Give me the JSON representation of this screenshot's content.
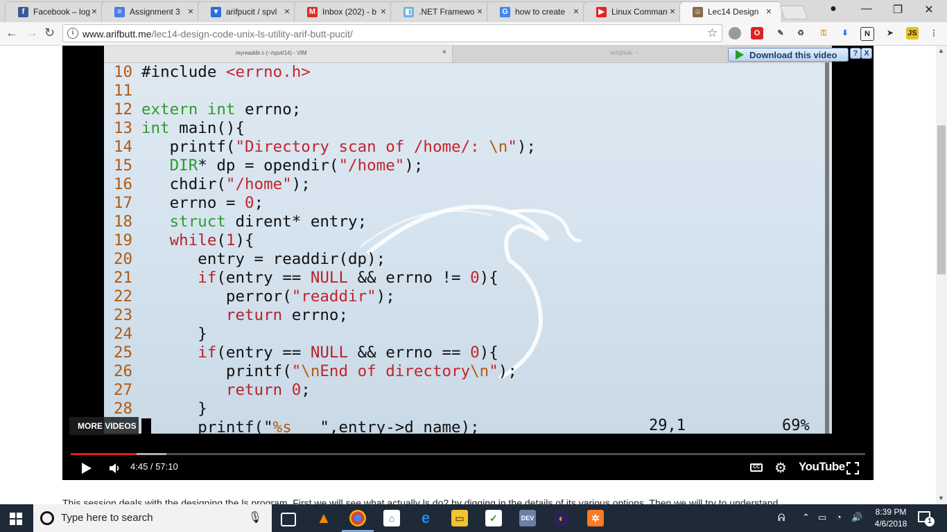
{
  "tabs": [
    {
      "title": "Facebook – log",
      "color": "#3b5998",
      "glyph": "f",
      "active": false
    },
    {
      "title": "Assignment 3",
      "color": "#4a7ee8",
      "glyph": "≡",
      "active": false
    },
    {
      "title": "arifpucit / spvl",
      "color": "#2b6ee0",
      "glyph": "▾",
      "active": false
    },
    {
      "title": "Inbox (202) - b",
      "color": "#d93025",
      "glyph": "M",
      "active": false
    },
    {
      "title": ".NET Framewo",
      "color": "#6fb3e0",
      "glyph": "◧",
      "active": false
    },
    {
      "title": "how to create",
      "color": "#4285f4",
      "glyph": "G",
      "active": false
    },
    {
      "title": "Linux Comman",
      "color": "#e52222",
      "glyph": "▶",
      "active": false
    },
    {
      "title": "Lec14 Design",
      "color": "#8a6a4a",
      "glyph": "☺",
      "active": true
    }
  ],
  "address": {
    "host": "www.arifbutt.me",
    "path": "/lec14-design-code-unix-ls-utility-arif-butt-pucit/"
  },
  "video": {
    "vim_tab_title": "myreaddir.c (~/spvl/14) - VIM",
    "terminal_tab_title": "arif@kali: ~",
    "download_label": "Download this video",
    "help_label": "?",
    "close_label": "X",
    "more_videos": "MORE VIDEOS",
    "time": "4:45 / 57:10",
    "played_fraction": 0.083,
    "buffered_fraction": 0.12,
    "cursor_pos": "29,1",
    "scroll_percent": "69%",
    "youtube_label": "YouTube",
    "code_lines": [
      {
        "n": "10",
        "segs": [
          [
            "#include ",
            ""
          ],
          [
            "<errno.h>",
            "str"
          ]
        ]
      },
      {
        "n": "11",
        "segs": []
      },
      {
        "n": "12",
        "segs": [
          [
            "extern int",
            "kw"
          ],
          [
            " errno;",
            ""
          ]
        ]
      },
      {
        "n": "13",
        "segs": [
          [
            "int",
            "kw"
          ],
          [
            " main(){",
            ""
          ]
        ]
      },
      {
        "n": "14",
        "segs": [
          [
            "   printf(",
            ""
          ],
          [
            "\"Directory scan of /home/: ",
            "str"
          ],
          [
            "\\n",
            "esc"
          ],
          [
            "\"",
            "str"
          ],
          [
            ");",
            ""
          ]
        ]
      },
      {
        "n": "15",
        "segs": [
          [
            "   ",
            ""
          ],
          [
            "DIR",
            "kw"
          ],
          [
            "* dp = opendir(",
            ""
          ],
          [
            "\"/home\"",
            "str"
          ],
          [
            ");",
            ""
          ]
        ]
      },
      {
        "n": "16",
        "segs": [
          [
            "   chdir(",
            ""
          ],
          [
            "\"/home\"",
            "str"
          ],
          [
            ");",
            ""
          ]
        ]
      },
      {
        "n": "17",
        "segs": [
          [
            "   errno = ",
            ""
          ],
          [
            "0",
            "num"
          ],
          [
            ";",
            ""
          ]
        ]
      },
      {
        "n": "18",
        "segs": [
          [
            "   ",
            ""
          ],
          [
            "struct",
            "kw"
          ],
          [
            " dirent* entry;",
            ""
          ]
        ]
      },
      {
        "n": "19",
        "segs": [
          [
            "   ",
            ""
          ],
          [
            "while",
            "kw2"
          ],
          [
            "(",
            ""
          ],
          [
            "1",
            "num"
          ],
          [
            "){",
            ""
          ]
        ]
      },
      {
        "n": "20",
        "segs": [
          [
            "      entry = readdir(dp);",
            ""
          ]
        ]
      },
      {
        "n": "21",
        "segs": [
          [
            "      ",
            ""
          ],
          [
            "if",
            "kw2"
          ],
          [
            "(entry == ",
            ""
          ],
          [
            "NULL",
            "kw2"
          ],
          [
            " && errno != ",
            ""
          ],
          [
            "0",
            "num"
          ],
          [
            "){",
            ""
          ]
        ]
      },
      {
        "n": "22",
        "segs": [
          [
            "         perror(",
            ""
          ],
          [
            "\"readdir\"",
            "str"
          ],
          [
            ");",
            ""
          ]
        ]
      },
      {
        "n": "23",
        "segs": [
          [
            "         ",
            ""
          ],
          [
            "return",
            "kw2"
          ],
          [
            " errno;",
            ""
          ]
        ]
      },
      {
        "n": "24",
        "segs": [
          [
            "      }",
            ""
          ]
        ]
      },
      {
        "n": "25",
        "segs": [
          [
            "      ",
            ""
          ],
          [
            "if",
            "kw2"
          ],
          [
            "(entry == ",
            ""
          ],
          [
            "NULL",
            "kw2"
          ],
          [
            " && errno == ",
            ""
          ],
          [
            "0",
            "num"
          ],
          [
            "){",
            ""
          ]
        ]
      },
      {
        "n": "26",
        "segs": [
          [
            "         printf(",
            ""
          ],
          [
            "\"",
            "str"
          ],
          [
            "\\n",
            "esc"
          ],
          [
            "End of directory",
            "str"
          ],
          [
            "\\n",
            "esc"
          ],
          [
            "\"",
            "str"
          ],
          [
            ");",
            ""
          ]
        ]
      },
      {
        "n": "27",
        "segs": [
          [
            "         ",
            ""
          ],
          [
            "return",
            "kw2"
          ],
          [
            " ",
            ""
          ],
          [
            "0",
            "num"
          ],
          [
            ";",
            ""
          ]
        ]
      },
      {
        "n": "28",
        "segs": [
          [
            "      }",
            ""
          ]
        ]
      },
      {
        "n": "",
        "segs": [
          [
            "      printf(\"",
            ""
          ],
          [
            "%s",
            "esc"
          ],
          [
            "   \",entry->d_name);",
            ""
          ]
        ]
      }
    ]
  },
  "description": "This session deals with the designing the ls program. First we will see what actually ls do? by digging in the details of its various options. Then we will try to understand",
  "taskbar": {
    "search_placeholder": "Type here to search",
    "time": "8:39 PM",
    "date": "4/6/2018",
    "notifications": "1"
  }
}
